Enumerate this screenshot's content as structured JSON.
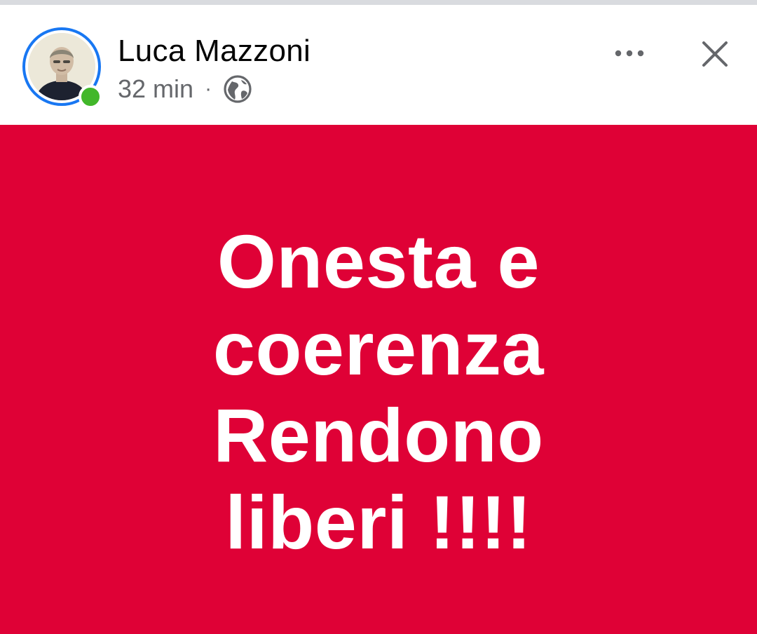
{
  "post": {
    "author": "Luca Mazzoni",
    "time": "32 min",
    "separator": "·",
    "privacy_icon": "globe-icon",
    "online": true,
    "more_icon": "more-dots-icon",
    "close_icon": "close-icon",
    "background_color": "#df0136",
    "text_lines": [
      "Onesta e",
      "coerenza",
      "Rendono",
      "liberi !!!!"
    ]
  },
  "colors": {
    "ring": "#1877f2",
    "online": "#42b72a",
    "name": "#050505",
    "meta": "#65676b"
  }
}
